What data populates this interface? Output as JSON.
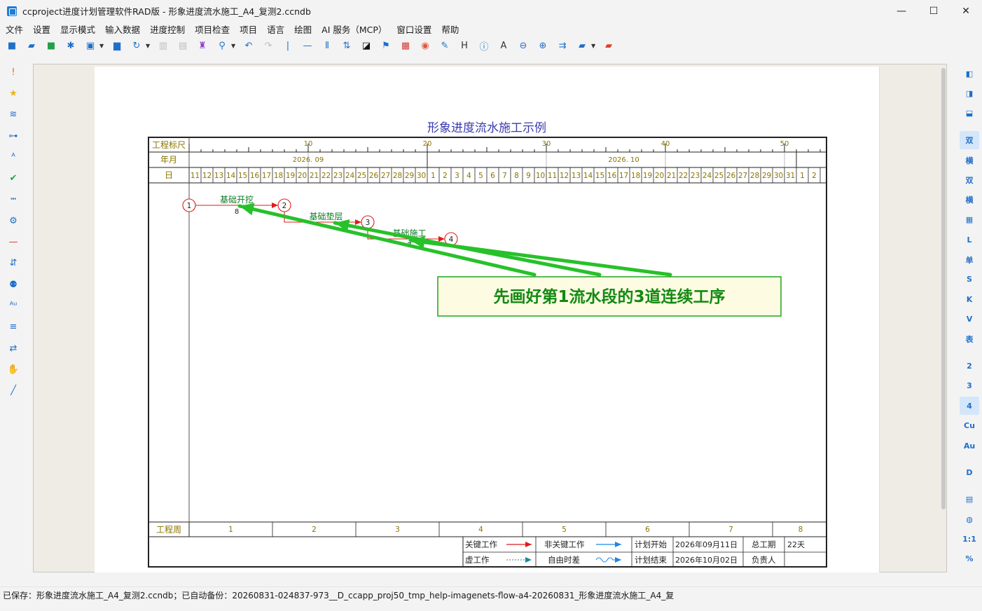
{
  "window": {
    "title": "ccproject进度计划管理软件RAD版 - 形象进度流水施工_A4_复测2.ccndb",
    "minimize_glyph": "—",
    "maximize_glyph": "☐",
    "close_glyph": "✕"
  },
  "menu": [
    "文件",
    "设置",
    "显示模式",
    "输入数据",
    "进度控制",
    "项目检查",
    "项目",
    "语言",
    "绘图",
    "AI 服务（MCP）",
    "窗口设置",
    "帮助"
  ],
  "toolbar_icons": [
    {
      "name": "new-icon",
      "glyph": "■",
      "color": "#1f6fc9"
    },
    {
      "name": "open-folder-icon",
      "glyph": "▰",
      "color": "#1f6fc9"
    },
    {
      "name": "save-icon",
      "glyph": "■",
      "color": "#22a04a"
    },
    {
      "name": "star-burst-icon",
      "glyph": "✱",
      "color": "#1f6fc9"
    },
    {
      "name": "image-icon",
      "glyph": "▣",
      "color": "#1f6fc9",
      "caret": true
    },
    {
      "name": "print-icon",
      "glyph": "▆",
      "color": "#1f6fc9"
    },
    {
      "name": "refresh-icon",
      "glyph": "↻",
      "color": "#1f6fc9",
      "caret": true
    },
    {
      "name": "copy-icon",
      "glyph": "▥",
      "color": "#bdbdbd"
    },
    {
      "name": "paste-icon",
      "glyph": "▤",
      "color": "#bdbdbd"
    },
    {
      "name": "format-brush-icon",
      "glyph": "♜",
      "color": "#8a3fd1"
    },
    {
      "name": "search-icon",
      "glyph": "⚲",
      "color": "#1f6fc9",
      "caret": true
    },
    {
      "name": "undo-icon",
      "glyph": "↶",
      "color": "#1f6fc9"
    },
    {
      "name": "redo-icon",
      "glyph": "↷",
      "color": "#bdbdbd"
    },
    {
      "name": "vertical-line-icon",
      "glyph": "|",
      "color": "#1f6fc9"
    },
    {
      "name": "horizontal-line-icon",
      "glyph": "—",
      "color": "#1f6fc9"
    },
    {
      "name": "columns-icon",
      "glyph": "⦀",
      "color": "#1f6fc9"
    },
    {
      "name": "sort-icon",
      "glyph": "⇅",
      "color": "#1f6fc9"
    },
    {
      "name": "contrast-icon",
      "glyph": "◪",
      "color": "#111111"
    },
    {
      "name": "flag-icon",
      "glyph": "⚑",
      "color": "#1f6fc9"
    },
    {
      "name": "report-icon",
      "glyph": "▦",
      "color": "#d23a3a"
    },
    {
      "name": "palette-icon",
      "glyph": "◉",
      "color": "#e0573b"
    },
    {
      "name": "edit-note-icon",
      "glyph": "✎",
      "color": "#1f6fc9"
    },
    {
      "name": "h-letter-icon",
      "glyph": "H",
      "color": "#333333"
    },
    {
      "name": "info-icon",
      "glyph": "ⓘ",
      "color": "#1f6fc9"
    },
    {
      "name": "font-a-icon",
      "glyph": "A",
      "color": "#333333"
    },
    {
      "name": "zoom-out-icon",
      "glyph": "⊖",
      "color": "#1f6fc9"
    },
    {
      "name": "zoom-in-icon",
      "glyph": "⊕",
      "color": "#1f6fc9"
    },
    {
      "name": "merge-arrows-icon",
      "glyph": "⇉",
      "color": "#1f6fc9"
    },
    {
      "name": "folder-icon",
      "glyph": "▰",
      "color": "#1f6fc9",
      "caret": true
    },
    {
      "name": "red-folder-icon",
      "glyph": "▰",
      "color": "#e0402e"
    }
  ],
  "left_icons": [
    {
      "name": "exclamation-icon",
      "glyph": "!",
      "color": "#e26a1f"
    },
    {
      "name": "star-icon",
      "glyph": "★",
      "color": "#e8b422"
    },
    {
      "name": "wave-icon",
      "glyph": "≋",
      "color": "#1f6fc9"
    },
    {
      "name": "link-icon",
      "glyph": "⊶",
      "color": "#1f6fc9"
    },
    {
      "name": "spell-check-icon",
      "glyph": "ᴬ",
      "color": "#1f6fc9"
    },
    {
      "name": "check-icon",
      "glyph": "✔",
      "color": "#22a04a"
    },
    {
      "name": "dotted-line-icon",
      "glyph": "┅",
      "color": "#1f6fc9"
    },
    {
      "name": "gear-icon",
      "glyph": "⚙",
      "color": "#1f6fc9"
    },
    {
      "name": "minus-icon",
      "glyph": "—",
      "color": "#d23a3a"
    },
    {
      "name": "sort-list-icon",
      "glyph": "⇵",
      "color": "#1f6fc9"
    },
    {
      "name": "users-icon",
      "glyph": "⚉",
      "color": "#1f6fc9"
    },
    {
      "name": "au-icon",
      "glyph": "ᴬᵘ",
      "color": "#1f6fc9"
    },
    {
      "name": "filter-icon",
      "glyph": "≡",
      "color": "#1f6fc9"
    },
    {
      "name": "swap-icon",
      "glyph": "⇄",
      "color": "#1f6fc9"
    },
    {
      "name": "hand-icon",
      "glyph": "✋",
      "color": "#111111"
    },
    {
      "name": "pen-icon",
      "glyph": "╱",
      "color": "#1f6fc9"
    }
  ],
  "right_icons": [
    {
      "name": "panel-left-icon",
      "glyph": "◧",
      "active": false,
      "sep": false
    },
    {
      "name": "panel-right-icon",
      "glyph": "◨",
      "active": false,
      "sep": false
    },
    {
      "name": "panel-bottom-icon",
      "glyph": "⬓",
      "active": false,
      "sep": true
    },
    {
      "name": "double-mode-icon",
      "glyph": "双",
      "active": true,
      "sep": false
    },
    {
      "name": "horizontal-mode-icon",
      "glyph": "横",
      "active": false,
      "sep": false
    },
    {
      "name": "double-settings-icon",
      "glyph": "双",
      "active": false,
      "sep": false
    },
    {
      "name": "horizontal-settings-icon",
      "glyph": "横",
      "active": false,
      "sep": false
    },
    {
      "name": "grid-table-icon",
      "glyph": "▦",
      "active": false,
      "sep": false
    },
    {
      "name": "l-letter-icon",
      "glyph": "L",
      "active": false,
      "sep": false
    },
    {
      "name": "single-icon",
      "glyph": "单",
      "active": false,
      "sep": false
    },
    {
      "name": "s-letter-icon",
      "glyph": "S",
      "active": false,
      "sep": false
    },
    {
      "name": "k-letter-icon",
      "glyph": "K",
      "active": false,
      "sep": false
    },
    {
      "name": "v-letter-icon",
      "glyph": "V",
      "active": false,
      "sep": false
    },
    {
      "name": "table-icon",
      "glyph": "表",
      "active": false,
      "sep": true
    },
    {
      "name": "level-2-icon",
      "glyph": "2",
      "active": false,
      "sep": false
    },
    {
      "name": "level-3-icon",
      "glyph": "3",
      "active": false,
      "sep": false
    },
    {
      "name": "level-4-icon",
      "glyph": "4",
      "active": true,
      "sep": false
    },
    {
      "name": "cu-icon",
      "glyph": "Cu",
      "active": false,
      "sep": false
    },
    {
      "name": "au-icon",
      "glyph": "Au",
      "active": false,
      "sep": true
    },
    {
      "name": "d-letter-icon",
      "glyph": "D",
      "active": false,
      "sep": true
    },
    {
      "name": "calculator-icon",
      "glyph": "▤",
      "active": false,
      "sep": false
    },
    {
      "name": "comment-icon",
      "glyph": "◍",
      "active": false,
      "sep": false
    },
    {
      "name": "ratio-icon",
      "glyph": "1:1",
      "active": false,
      "sep": false
    },
    {
      "name": "percent-icon",
      "glyph": "%",
      "active": false,
      "sep": false
    }
  ],
  "chart": {
    "title": "形象进度流水施工示例",
    "row_labels": {
      "ruler": "工程标尺",
      "month": "年月",
      "day": "日",
      "week": "工程周"
    },
    "ruler_marks": [
      "10",
      "20",
      "30",
      "40",
      "50"
    ],
    "months": [
      "2026. 09",
      "2026. 10"
    ],
    "days": [
      "11",
      "12",
      "13",
      "14",
      "15",
      "16",
      "17",
      "18",
      "19",
      "20",
      "21",
      "22",
      "23",
      "24",
      "25",
      "26",
      "27",
      "28",
      "29",
      "30",
      "1",
      "2",
      "3",
      "4",
      "5",
      "6",
      "7",
      "8",
      "9",
      "10",
      "11",
      "12",
      "13",
      "14",
      "15",
      "16",
      "17",
      "18",
      "19",
      "20",
      "21",
      "22",
      "23",
      "24",
      "25",
      "26",
      "27",
      "28",
      "29",
      "30",
      "31",
      "1",
      "2"
    ],
    "weeks": [
      "1",
      "2",
      "3",
      "4",
      "5",
      "6",
      "7",
      "8"
    ],
    "nodes": [
      {
        "label": "1",
        "day_index": 0
      },
      {
        "label": "2",
        "day_index": 8
      },
      {
        "label": "3",
        "day_index": 15
      },
      {
        "label": "4",
        "day_index": 22
      }
    ],
    "tasks": [
      {
        "name": "基础开挖",
        "duration": "8",
        "start_day_index": 0,
        "end_day_index": 8,
        "critical": true
      },
      {
        "name": "基础垫层",
        "duration": "",
        "start_day_index": 8,
        "end_day_index": 15,
        "critical": true
      },
      {
        "name": "基础施工",
        "duration": "7",
        "start_day_index": 15,
        "end_day_index": 22,
        "critical": true
      }
    ],
    "legend": {
      "critical": "关键工作",
      "noncritical": "非关键工作",
      "virtual": "虚工作",
      "float": "自由时差",
      "plan_start_label": "计划开始",
      "plan_start": "2026年09月11日",
      "plan_end_label": "计划结束",
      "plan_end": "2026年10月02日",
      "duration_label": "总工期",
      "duration": "22天",
      "owner_label": "负责人",
      "owner": ""
    }
  },
  "callout": {
    "text": "先画好第1流水段的3道连续工序"
  },
  "status": {
    "text": "已保存：形象进度流水施工_A4_复测2.ccndb；已自动备份：20260831-024837-973__D_ccapp_proj50_tmp_help-imagenets-flow-a4-20260831_形象进度流水施工_A4_复"
  }
}
